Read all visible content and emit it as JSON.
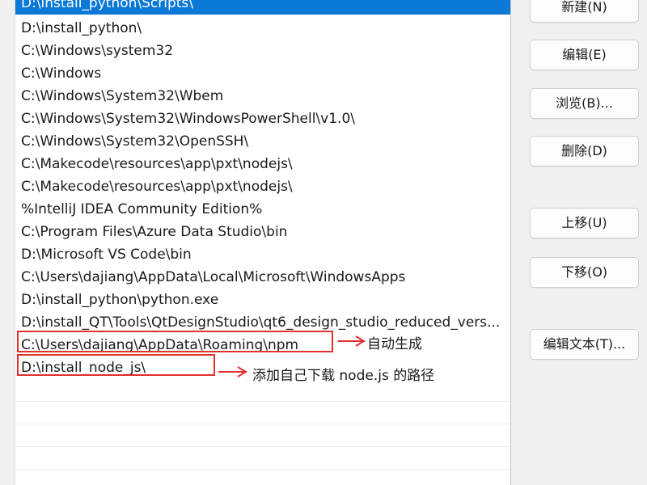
{
  "dialog": {
    "paths": [
      "D:\\install_python\\Scripts\\",
      "D:\\install_python\\",
      "C:\\Windows\\system32",
      "C:\\Windows",
      "C:\\Windows\\System32\\Wbem",
      "C:\\Windows\\System32\\WindowsPowerShell\\v1.0\\",
      "C:\\Windows\\System32\\OpenSSH\\",
      "C:\\Makecode\\resources\\app\\pxt\\nodejs\\",
      "C:\\Makecode\\resources\\app\\pxt\\nodejs\\",
      "%IntelliJ IDEA Community Edition%",
      "C:\\Program Files\\Azure Data Studio\\bin",
      "D:\\Microsoft VS Code\\bin",
      "C:\\Users\\dajiang\\AppData\\Local\\Microsoft\\WindowsApps",
      "D:\\install_python\\python.exe",
      "D:\\install_QT\\Tools\\QtDesignStudio\\qt6_design_studio_reduced_vers...",
      "C:\\Users\\dajiang\\AppData\\Roaming\\npm",
      "D:\\install_node_js\\"
    ],
    "selected_index": 0,
    "buttons": {
      "new": "新建(N)",
      "edit": "编辑(E)",
      "browse": "浏览(B)...",
      "delete": "删除(D)",
      "move_up": "上移(U)",
      "move_down": "下移(O)",
      "edit_text": "编辑文本(T)..."
    }
  },
  "annotations": {
    "auto_generated": "自动生成",
    "added_nodejs": "添加自己下载 node.js 的路径",
    "color": "#e0302f"
  },
  "colors": {
    "selection": "#0a78d7",
    "list_bg": "#ffffff",
    "dialog_bg": "#f0f0f0"
  }
}
